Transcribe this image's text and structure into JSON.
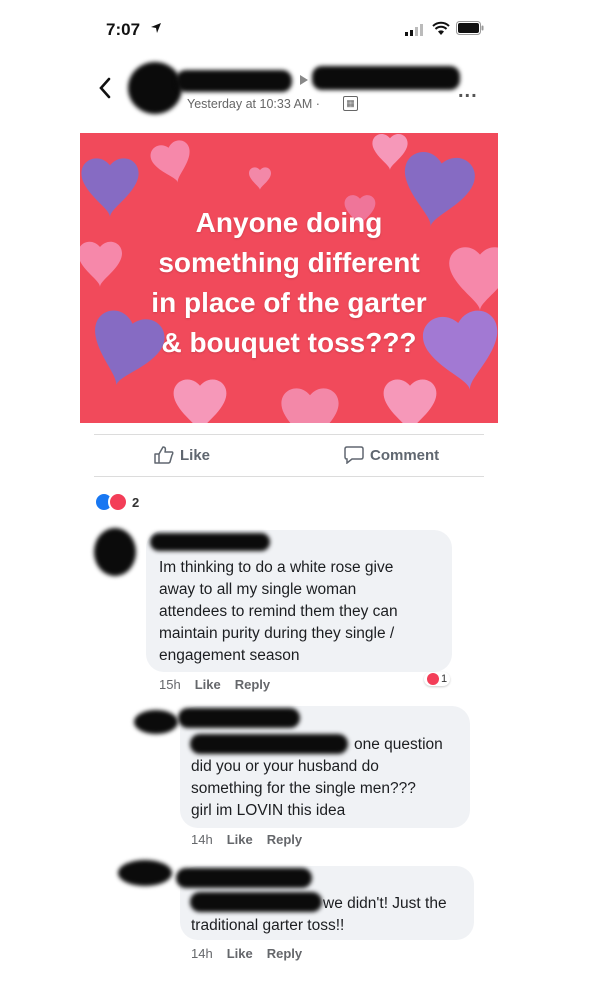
{
  "status_bar": {
    "time": "7:07"
  },
  "post": {
    "timestamp": "Yesterday at 10:33 AM ·",
    "image_text": [
      "Anyone doing",
      "something different",
      "in place of the garter",
      "& bouquet toss???"
    ],
    "more_label": "...",
    "privacy_icon": "calendar-icon",
    "image_bg_color": "#f14a5b"
  },
  "actions": {
    "like_label": "Like",
    "comment_label": "Comment"
  },
  "reactions": {
    "count": "2"
  },
  "comments": [
    {
      "lines": [
        "Im thinking to do a white rose give",
        "away to all my single woman",
        "attendees to remind them they can",
        "maintain purity during they single /",
        "engagement season"
      ],
      "time": "15h",
      "like": "Like",
      "reply": "Reply",
      "reaction_count": "1"
    },
    {
      "lines": [
        "one question",
        "did you or your husband do",
        "something for the single men???",
        "girl im LOVIN this idea"
      ],
      "time": "14h",
      "like": "Like",
      "reply": "Reply"
    },
    {
      "lines": [
        "we didn't! Just the",
        "traditional garter toss!!"
      ],
      "time": "14h",
      "like": "Like",
      "reply": "Reply"
    }
  ]
}
